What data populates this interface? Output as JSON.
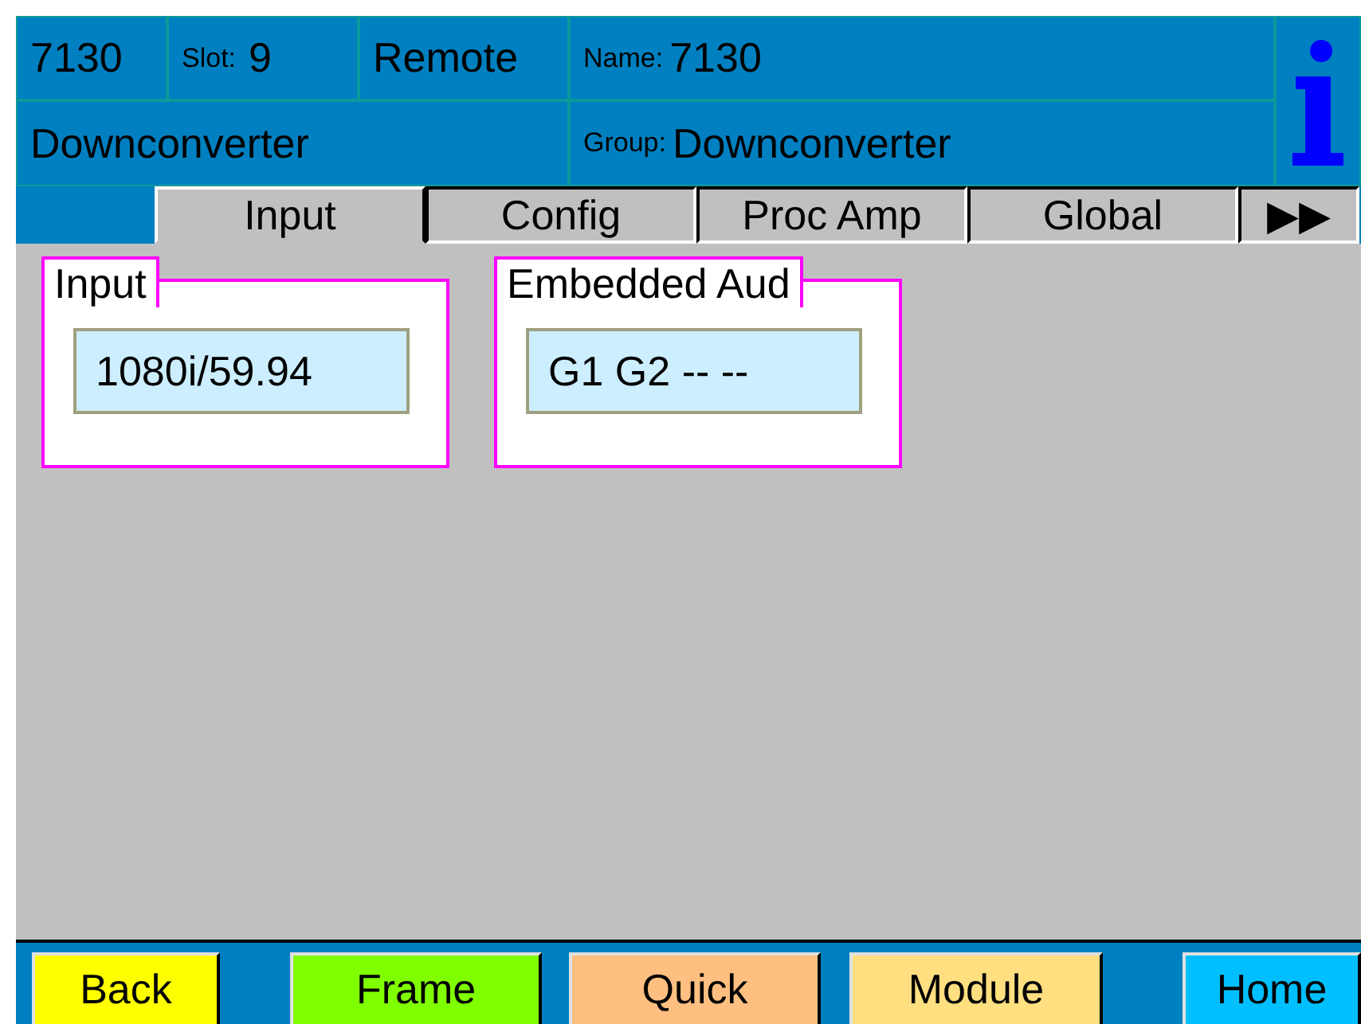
{
  "header": {
    "id": "7130",
    "slot_label": "Slot:",
    "slot": "9",
    "mode": "Remote",
    "name_label": "Name:",
    "name": "7130",
    "type": "Downconverter",
    "group_label": "Group:",
    "group": "Downconverter"
  },
  "tabs": [
    {
      "label": "Input",
      "selected": true
    },
    {
      "label": "Config",
      "selected": false
    },
    {
      "label": "Proc Amp",
      "selected": false
    },
    {
      "label": "Global",
      "selected": false
    },
    {
      "label": "▶▶",
      "selected": false
    }
  ],
  "panels": [
    {
      "title": "Input",
      "value": "1080i/59.94"
    },
    {
      "title": "Embedded Aud",
      "value": "G1 G2 -- --"
    }
  ],
  "buttons": [
    {
      "label": "Back",
      "color": "#ffff00"
    },
    {
      "label": "Frame",
      "color": "#80ff00"
    },
    {
      "label": "Quick",
      "color": "#ffbf80"
    },
    {
      "label": "Module",
      "color": "#ffdf80"
    },
    {
      "label": "Home",
      "color": "#00bfff"
    }
  ]
}
